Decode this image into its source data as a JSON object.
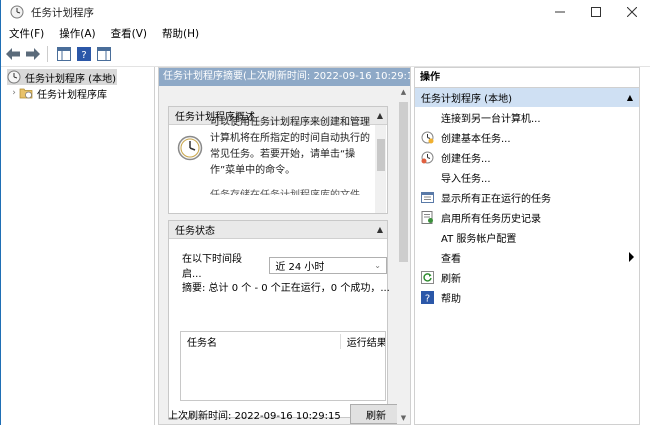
{
  "window": {
    "title": "任务计划程序",
    "controls": [
      "minimize",
      "maximize",
      "close"
    ]
  },
  "menu": [
    "文件(F)",
    "操作(A)",
    "查看(V)",
    "帮助(H)"
  ],
  "toolbar_icons": [
    "back-arrow-icon",
    "forward-arrow-icon",
    "console-tree-icon",
    "help-icon",
    "show-pane-icon"
  ],
  "tree": {
    "root": "任务计划程序 (本地)",
    "child": "任务计划程序库"
  },
  "middle": {
    "header": "任务计划程序摘要(上次刷新时间: 2022-09-16 10:29:15)",
    "overview": {
      "title": "任务计划程序概述",
      "text": "可以使用任务计划程序来创建和管理计算机将在所指定的时间自动执行的常见任务。若要开始，请单击“操作”菜单中的命令。",
      "text_more": "任务存储在任务计划程序库的文件"
    },
    "status": {
      "title": "任务状态",
      "period_label": "在以下时间段启...",
      "period_value": "近 24 小时",
      "summary": "摘要: 总计 0 个 - 0 个正在运行，0 个成功，...",
      "columns": [
        "任务名",
        "运行结果"
      ]
    },
    "last_refresh": "上次刷新时间: 2022-09-16 10:29:15",
    "refresh_button": "刷新"
  },
  "actions": {
    "header": "操作",
    "group": "任务计划程序 (本地)",
    "items": [
      {
        "label": "连接到另一台计算机...",
        "icon": ""
      },
      {
        "label": "创建基本任务...",
        "icon": "create-basic-task-icon"
      },
      {
        "label": "创建任务...",
        "icon": "create-task-icon"
      },
      {
        "label": "导入任务...",
        "icon": ""
      },
      {
        "label": "显示所有正在运行的任务",
        "icon": "running-tasks-icon"
      },
      {
        "label": "启用所有任务历史记录",
        "icon": "history-icon"
      },
      {
        "label": "AT 服务帐户配置",
        "icon": ""
      },
      {
        "label": "查看",
        "icon": "",
        "submenu": true
      },
      {
        "label": "刷新",
        "icon": "refresh-icon"
      },
      {
        "label": "帮助",
        "icon": "help-icon"
      }
    ]
  },
  "colors": {
    "header_bar": "#8ea9c7",
    "action_group_bg": "#cfe0f3",
    "tree_selected": "#d9d9d9"
  }
}
